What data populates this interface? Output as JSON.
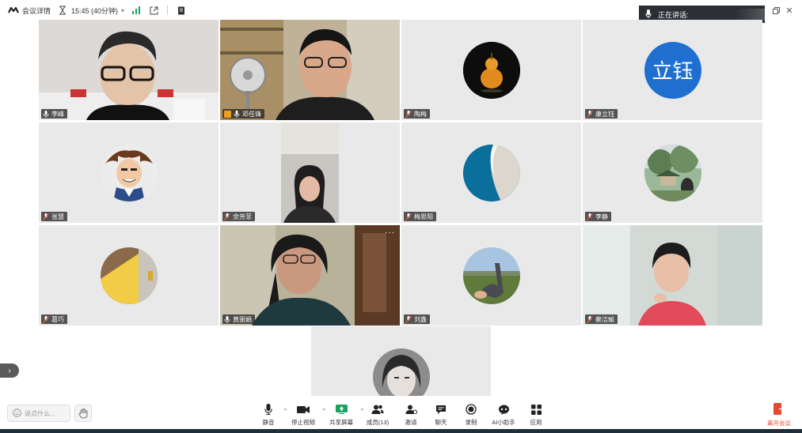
{
  "topbar": {
    "meeting_details": "会议详情",
    "duration": "15:45 (40分钟)",
    "duration_caret": "▾"
  },
  "speaking": {
    "label": "正在讲话:"
  },
  "participants": [
    {
      "name": "李峰",
      "type": "video",
      "bg": "#d8d4d0"
    },
    {
      "name": "邓任锋",
      "type": "video",
      "bg": "#b7a88e"
    },
    {
      "name": "陶梅",
      "type": "avatar",
      "avatar": "gourd"
    },
    {
      "name": "康立钰",
      "type": "avatar",
      "avatar": "text",
      "avatar_text": "立钰",
      "avatar_color": "#1f6fd1"
    },
    {
      "name": "张慧",
      "type": "avatar",
      "avatar": "cartoon"
    },
    {
      "name": "余芳菲",
      "type": "video",
      "bg": "#e9e9e9"
    },
    {
      "name": "梅思阳",
      "type": "avatar",
      "avatar": "ocean"
    },
    {
      "name": "李静",
      "type": "avatar",
      "avatar": "park"
    },
    {
      "name": "葛巧",
      "type": "avatar",
      "avatar": "yellow"
    },
    {
      "name": "黄丽娟",
      "type": "video",
      "bg": "#6f6a58"
    },
    {
      "name": "刘鑫",
      "type": "avatar",
      "avatar": "field"
    },
    {
      "name": "赖洁瑜",
      "type": "video",
      "bg": "#cfd6d2"
    }
  ],
  "more_icon": "···",
  "toolbar": {
    "chat_placeholder": "说点什么...",
    "buttons": [
      {
        "id": "mute",
        "label": "静音",
        "icon": "mic-icon",
        "caret": true
      },
      {
        "id": "video",
        "label": "停止视频",
        "icon": "camera-icon",
        "caret": true
      },
      {
        "id": "share",
        "label": "共享屏幕",
        "icon": "share-screen-icon",
        "caret": true,
        "color": "#1aa260"
      },
      {
        "id": "members",
        "label": "成员(13)",
        "icon": "members-icon",
        "caret": false
      },
      {
        "id": "invite",
        "label": "邀请",
        "icon": "invite-icon",
        "caret": false
      },
      {
        "id": "chat",
        "label": "聊天",
        "icon": "chat-icon",
        "caret": false
      },
      {
        "id": "record",
        "label": "录制",
        "icon": "record-icon",
        "caret": false
      },
      {
        "id": "ai",
        "label": "AI小助手",
        "icon": "ai-assistant-icon",
        "caret": false
      },
      {
        "id": "apps",
        "label": "应用",
        "icon": "apps-icon",
        "caret": false
      }
    ],
    "leave_label": "离开会议",
    "leave_color": "#e5492f"
  },
  "side_arrow": "›"
}
